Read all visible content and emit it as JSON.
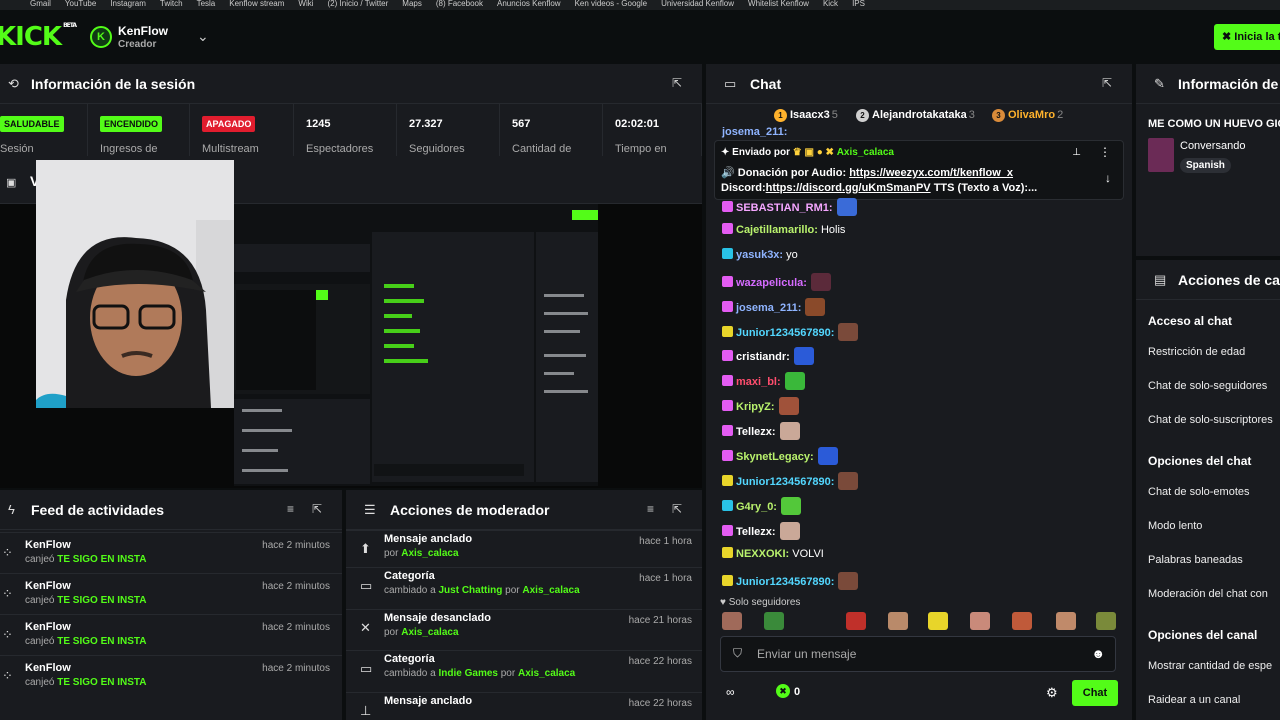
{
  "bookmarks": [
    "Gmail",
    "YouTube",
    "Instagram",
    "Twitch",
    "Tesla",
    "Kenflow stream",
    "Wiki",
    "(2) Inicio / Twitter",
    "Maps",
    "(8) Facebook",
    "Anuncios Kenflow",
    "Ken videos - Google",
    "Universidad Kenflow",
    "Whitelist Kenflow",
    "Kick",
    "IPS"
  ],
  "header": {
    "logo": "KICK",
    "logo_beta": "BETA",
    "channel": "KenFlow",
    "role": "Creador",
    "go_live": "Inicia la t"
  },
  "session": {
    "title": "Información de la sesión",
    "stats": [
      {
        "badge": "SALUDABLE",
        "label": "Sesión",
        "kind": "green"
      },
      {
        "badge": "ENCENDIDO",
        "label": "Ingresos de",
        "kind": "green"
      },
      {
        "badge": "APAGADO",
        "label": "Multistream",
        "kind": "red"
      },
      {
        "value": "1245",
        "label": "Espectadores"
      },
      {
        "value": "27.327",
        "label": "Seguidores"
      },
      {
        "value": "567",
        "label": "Cantidad de"
      },
      {
        "value": "02:02:01",
        "label": "Tiempo en"
      }
    ]
  },
  "video": {
    "title": "V"
  },
  "feed": {
    "title": "Feed de actividades",
    "items": [
      {
        "name": "KenFlow",
        "action": "canjeó",
        "reward": "TE SIGO EN INSTA",
        "time": "hace 2 minutos"
      },
      {
        "name": "KenFlow",
        "action": "canjeó",
        "reward": "TE SIGO EN INSTA",
        "time": "hace 2 minutos"
      },
      {
        "name": "KenFlow",
        "action": "canjeó",
        "reward": "TE SIGO EN INSTA",
        "time": "hace 2 minutos"
      },
      {
        "name": "KenFlow",
        "action": "canjeó",
        "reward": "TE SIGO EN INSTA",
        "time": "hace 2 minutos"
      }
    ]
  },
  "mod": {
    "title": "Acciones de moderador",
    "items": [
      {
        "title": "Mensaje anclado",
        "sub1": "por",
        "user": "Axis_calaca",
        "time": "hace 1 hora"
      },
      {
        "title": "Categoría",
        "sub1": "cambiado a",
        "cat": "Just Chatting",
        "sub2": "por",
        "user": "Axis_calaca",
        "time": "hace 1 hora"
      },
      {
        "title": "Mensaje desanclado",
        "sub1": "por",
        "user": "Axis_calaca",
        "time": "hace 21 horas"
      },
      {
        "title": "Categoría",
        "sub1": "cambiado a",
        "cat": "Indie Games",
        "sub2": "por",
        "user": "Axis_calaca",
        "time": "hace 22 horas"
      },
      {
        "title": "Mensaje anclado",
        "time": "hace 22 horas"
      }
    ]
  },
  "chat": {
    "title": "Chat",
    "leaders": [
      {
        "rank": "1",
        "name": "Isaacx3",
        "count": "5"
      },
      {
        "rank": "2",
        "name": "Alejandrotakataka",
        "count": "3"
      },
      {
        "rank": "3",
        "name": "OlivaMro",
        "count": "2"
      }
    ],
    "top_cut": "josema_211:",
    "pinned": {
      "label": "Enviado por",
      "user": "Axis_calaca",
      "line1_prefix": "Donación por Audio:",
      "line1_link": "https://weezyx.com/t/kenflow_x",
      "line2_prefix": "Discord:",
      "line2_link": "https://discord.gg/uKmSmanPV",
      "line2_suffix": "TTS (Texto a Voz):..."
    },
    "messages": [
      {
        "user": "SEBASTIAN_RM1:",
        "text": "",
        "color": "#f5a6ff"
      },
      {
        "user": "Cajetillamarillo:",
        "text": "Holis",
        "color": "#b9f26d"
      },
      {
        "user": "yasuk3x:",
        "text": "yo",
        "color": "#8fb4ff"
      },
      {
        "user": "wazapelicula:",
        "text": "",
        "color": "#d56bff"
      },
      {
        "user": "josema_211:",
        "text": "",
        "color": "#8fb4ff"
      },
      {
        "user": "Junior1234567890:",
        "text": "",
        "color": "#53d7ff"
      },
      {
        "user": "cristiandr:",
        "text": "",
        "color": "#ffffff"
      },
      {
        "user": "maxi_bl:",
        "text": "",
        "color": "#ff4d6d"
      },
      {
        "user": "KripyZ:",
        "text": "",
        "color": "#b9f26d"
      },
      {
        "user": "Tellezx:",
        "text": "",
        "color": "#ffffff"
      },
      {
        "user": "SkynetLegacy:",
        "text": "",
        "color": "#b9f26d"
      },
      {
        "user": "Junior1234567890:",
        "text": "",
        "color": "#53d7ff"
      },
      {
        "user": "G4ry_0:",
        "text": "",
        "color": "#b9f26d"
      },
      {
        "user": "Tellezx:",
        "text": "",
        "color": "#ffffff"
      },
      {
        "user": "NEXXOKI:",
        "text": "VOLVI",
        "color": "#b9f26d"
      },
      {
        "user": "Junior1234567890:",
        "text": "",
        "color": "#53d7ff"
      }
    ],
    "followers_only": "Solo seguidores",
    "input_placeholder": "Enviar un mensaje",
    "points": "0",
    "send": "Chat"
  },
  "right": {
    "title": "Información de",
    "stream_title": "ME COMO UN HUEVO GIG",
    "category": "Conversando",
    "language": "Spanish",
    "actions_title": "Acciones de ca",
    "sections": [
      {
        "title": "Acceso al chat",
        "items": [
          "Restricción de edad",
          "Chat de solo-seguidores",
          "Chat de solo-suscriptores"
        ]
      },
      {
        "title": "Opciones del chat",
        "items": [
          "Chat de solo-emotes",
          "Modo lento",
          "Palabras baneadas",
          "Moderación del chat con"
        ]
      },
      {
        "title": "Opciones del canal",
        "items": [
          "Mostrar cantidad de espe",
          "Raidear a un canal"
        ]
      }
    ]
  },
  "colors": {
    "accent": "#53fc18",
    "panel": "#191b1f",
    "bg": "#0b0e0f",
    "danger": "#e11d2e"
  }
}
